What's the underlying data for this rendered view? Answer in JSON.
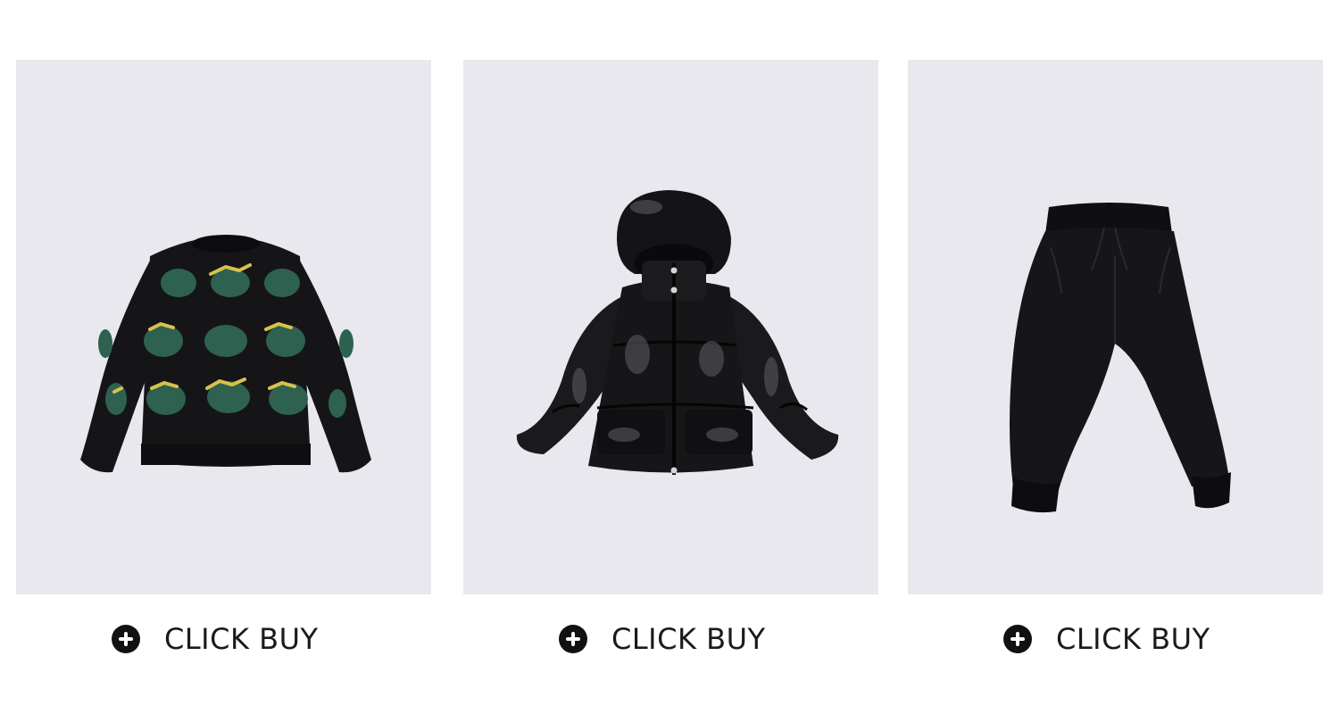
{
  "products": [
    {
      "name": "dinosaur-sweater",
      "buy_label": "CLICK BUY",
      "icon": "plus-circle-icon"
    },
    {
      "name": "glossy-puffer-jacket",
      "buy_label": "CLICK BUY",
      "icon": "plus-circle-icon"
    },
    {
      "name": "jogger-pants",
      "buy_label": "CLICK BUY",
      "icon": "plus-circle-icon"
    }
  ],
  "colors": {
    "card_background": "#e8e8ee",
    "icon": "#111111",
    "label": "#1a1a1a"
  }
}
